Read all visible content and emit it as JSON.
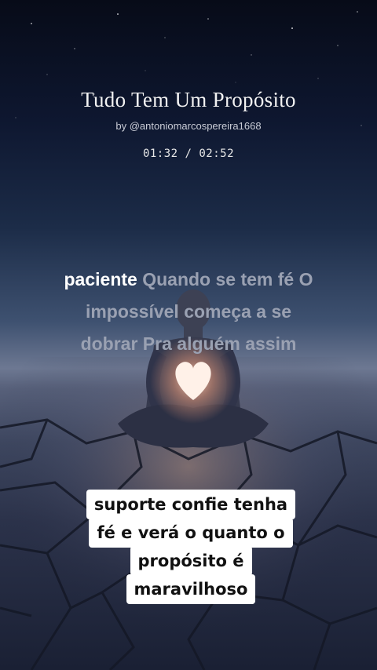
{
  "track": {
    "title": "Tudo Tem Um Propósito",
    "byline": "by @antoniomarcospereira1668",
    "time": "01:32 / 02:52"
  },
  "lyrics": {
    "active_word": "paciente",
    "line1_rest": " Quando se tem fé O",
    "line2": "impossível começa a se",
    "line3": "dobrar Pra alguém assim"
  },
  "caption": {
    "lines": [
      "suporte confie tenha",
      "fé e verá o quanto o",
      "propósito é",
      "maravilhoso"
    ]
  }
}
